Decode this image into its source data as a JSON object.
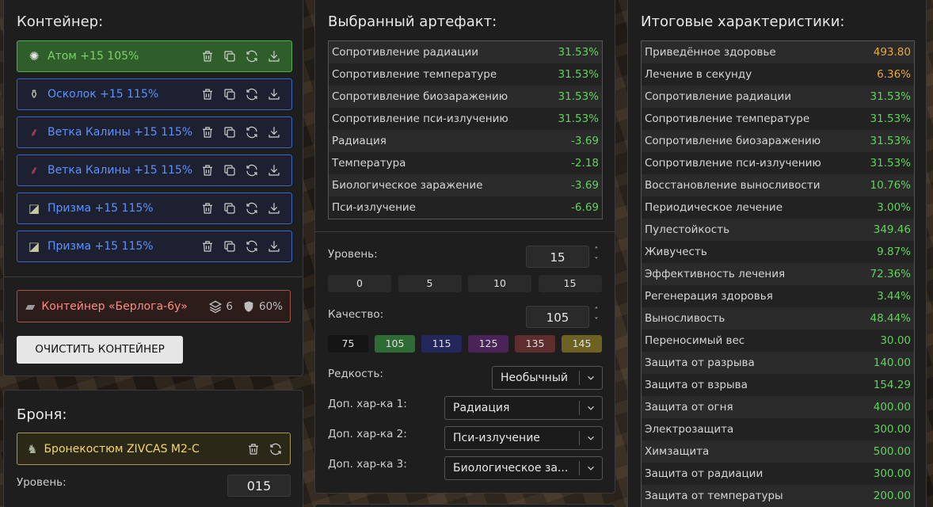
{
  "container": {
    "title": "Контейнер:",
    "items": [
      {
        "name": "Атом +15 105%",
        "icon": "atom-artifact-icon",
        "glyph": "✺",
        "color": "#e6e6e6"
      },
      {
        "name": "Осколок +15 115%",
        "icon": "shard-artifact-icon",
        "glyph": "⚱",
        "color": "#b9c0b0"
      },
      {
        "name": "Ветка Калины +15 115%",
        "icon": "viburnum-branch-icon",
        "glyph": "⸙",
        "color": "#c0505a"
      },
      {
        "name": "Ветка Калины +15 115%",
        "icon": "viburnum-branch-icon",
        "glyph": "⸙",
        "color": "#c0505a"
      },
      {
        "name": "Призма +15 115%",
        "icon": "prism-artifact-icon",
        "glyph": "◪",
        "color": "#c8c8a0"
      },
      {
        "name": "Призма +15 115%",
        "icon": "prism-artifact-icon",
        "glyph": "◪",
        "color": "#c8c8a0"
      }
    ],
    "box": {
      "name": "Контейнер «Берлога-6у»",
      "slots": "6",
      "protection": "60%"
    },
    "clear_button": "ОЧИСТИТЬ КОНТЕЙНЕР"
  },
  "armor": {
    "title": "Броня:",
    "name": "Бронекостюм ZIVCAS M2-C",
    "level_label": "Уровень:",
    "level_value": "015"
  },
  "artifact": {
    "title": "Выбранный артефакт:",
    "stats": [
      {
        "label": "Сопротивление радиации",
        "value": "31.53%",
        "color": "#5fd35a"
      },
      {
        "label": "Сопротивление температуре",
        "value": "31.53%",
        "color": "#5fd35a"
      },
      {
        "label": "Сопротивление биозаражению",
        "value": "31.53%",
        "color": "#5fd35a"
      },
      {
        "label": "Сопротивление пси-излучению",
        "value": "31.53%",
        "color": "#5fd35a"
      },
      {
        "label": "Радиация",
        "value": "-3.69",
        "color": "#5fd35a"
      },
      {
        "label": "Температура",
        "value": "-2.18",
        "color": "#5fd35a"
      },
      {
        "label": "Биологическое заражение",
        "value": "-3.69",
        "color": "#5fd35a"
      },
      {
        "label": "Пси-излучение",
        "value": "-6.69",
        "color": "#5fd35a"
      }
    ],
    "level_label": "Уровень:",
    "level_value": "15",
    "level_presets": [
      "0",
      "5",
      "10",
      "15"
    ],
    "quality_label": "Качество:",
    "quality_value": "105",
    "quality_presets": [
      {
        "label": "75",
        "color": "#151515"
      },
      {
        "label": "105",
        "color": "#2f6b34"
      },
      {
        "label": "115",
        "color": "#23275c"
      },
      {
        "label": "125",
        "color": "#4a2358"
      },
      {
        "label": "135",
        "color": "#5e2d2d"
      },
      {
        "label": "145",
        "color": "#6e6223"
      }
    ],
    "rarity_label": "Редкость:",
    "rarity_value": "Необычный",
    "extra1_label": "Доп. хар-ка 1:",
    "extra1_value": "Радиация",
    "extra2_label": "Доп. хар-ка 2:",
    "extra2_value": "Пси-излучение",
    "extra3_label": "Доп. хар-ка 3:",
    "extra3_value": "Биологическое за..."
  },
  "totals": {
    "title": "Итоговые характеристики:",
    "stats": [
      {
        "label": "Приведённое здоровье",
        "value": "493.80",
        "color": "#e6a93a"
      },
      {
        "label": "Лечение в секунду",
        "value": "6.36%",
        "color": "#e6a93a"
      },
      {
        "label": "Сопротивление радиации",
        "value": "31.53%",
        "color": "#5fd35a"
      },
      {
        "label": "Сопротивление температуре",
        "value": "31.53%",
        "color": "#5fd35a"
      },
      {
        "label": "Сопротивление биозаражению",
        "value": "31.53%",
        "color": "#5fd35a"
      },
      {
        "label": "Сопротивление пси-излучению",
        "value": "31.53%",
        "color": "#5fd35a"
      },
      {
        "label": "Восстановление выносливости",
        "value": "10.76%",
        "color": "#5fd35a"
      },
      {
        "label": "Периодическое лечение",
        "value": "3.00%",
        "color": "#5fd35a"
      },
      {
        "label": "Пулестойкость",
        "value": "349.46",
        "color": "#5fd35a"
      },
      {
        "label": "Живучесть",
        "value": "9.87%",
        "color": "#5fd35a"
      },
      {
        "label": "Эффективность лечения",
        "value": "72.36%",
        "color": "#5fd35a"
      },
      {
        "label": "Регенерация здоровья",
        "value": "3.44%",
        "color": "#5fd35a"
      },
      {
        "label": "Выносливость",
        "value": "48.44%",
        "color": "#5fd35a"
      },
      {
        "label": "Переносимый вес",
        "value": "30.00",
        "color": "#5fd35a"
      },
      {
        "label": "Защита от разрыва",
        "value": "140.00",
        "color": "#5fd35a"
      },
      {
        "label": "Защита от взрыва",
        "value": "154.29",
        "color": "#5fd35a"
      },
      {
        "label": "Защита от огня",
        "value": "400.00",
        "color": "#5fd35a"
      },
      {
        "label": "Электрозащита",
        "value": "300.00",
        "color": "#5fd35a"
      },
      {
        "label": "Химзащита",
        "value": "500.00",
        "color": "#5fd35a"
      },
      {
        "label": "Защита от радиации",
        "value": "300.00",
        "color": "#5fd35a"
      },
      {
        "label": "Защита от температуры",
        "value": "200.00",
        "color": "#5fd35a"
      }
    ]
  }
}
